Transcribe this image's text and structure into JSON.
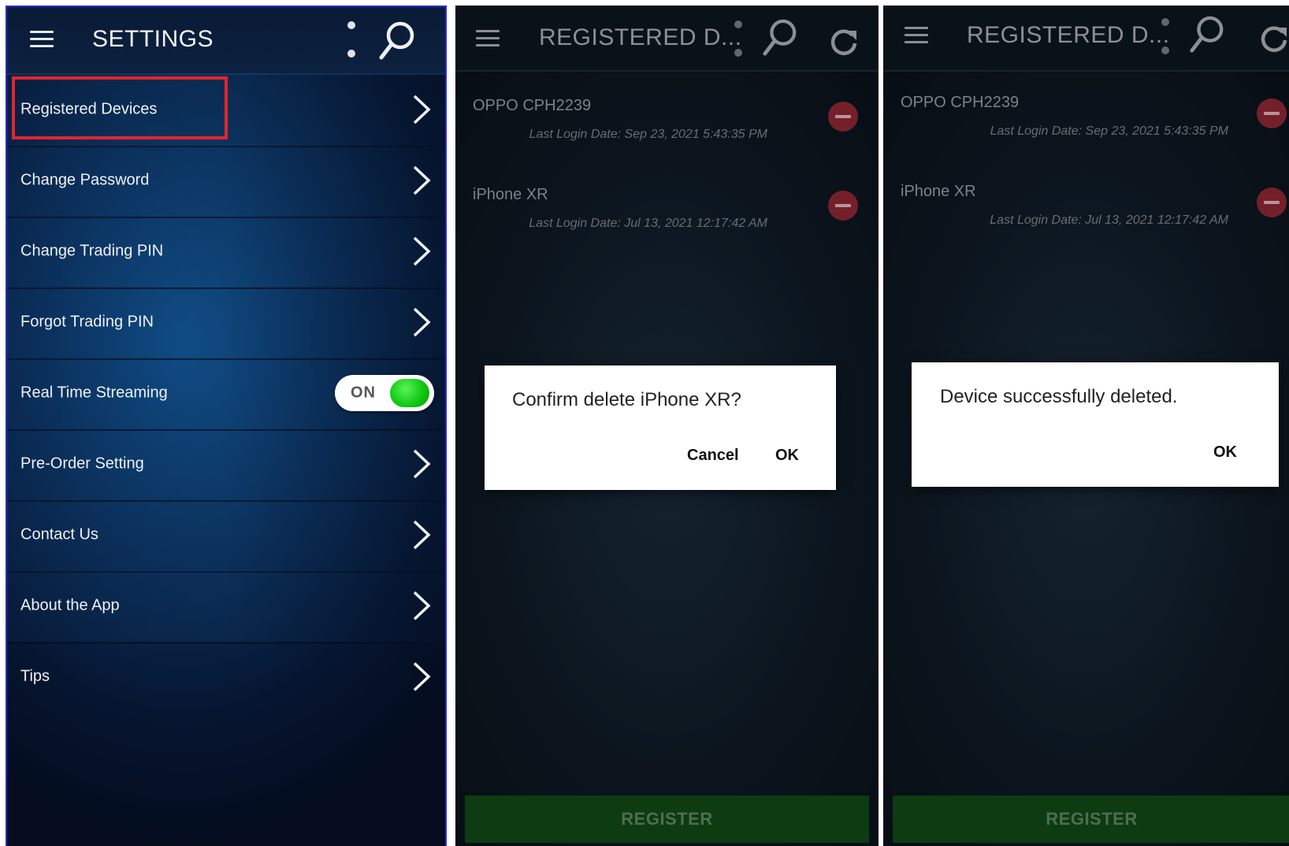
{
  "settings_screen": {
    "title": "SETTINGS",
    "items": [
      {
        "label": "Registered Devices",
        "type": "link"
      },
      {
        "label": "Change Password",
        "type": "link"
      },
      {
        "label": "Change Trading PIN",
        "type": "link"
      },
      {
        "label": "Forgot Trading PIN",
        "type": "link"
      },
      {
        "label": "Real Time Streaming",
        "type": "toggle",
        "toggle_text": "ON",
        "toggle_on": true
      },
      {
        "label": "Pre-Order Setting",
        "type": "link"
      },
      {
        "label": "Contact Us",
        "type": "link"
      },
      {
        "label": "About the App",
        "type": "link"
      },
      {
        "label": "Tips",
        "type": "link"
      }
    ],
    "highlight_color": "#e0262e",
    "toggle_color": "#12c912"
  },
  "confirm_screen": {
    "title": "REGISTERED D...",
    "devices": [
      {
        "name": "OPPO CPH2239",
        "last_login": "Last Login Date: Sep 23, 2021 5:43:35 PM"
      },
      {
        "name": "iPhone XR",
        "last_login": "Last Login Date: Jul 13, 2021 12:17:42 AM"
      }
    ],
    "dialog": {
      "message": "Confirm delete iPhone XR?",
      "cancel_label": "Cancel",
      "ok_label": "OK"
    },
    "register_label": "REGISTER"
  },
  "deleted_screen": {
    "title": "REGISTERED D...",
    "devices": [
      {
        "name": "OPPO CPH2239",
        "last_login": "Last Login Date: Sep 23, 2021 5:43:35 PM"
      },
      {
        "name": "iPhone XR",
        "last_login": "Last Login Date: Jul 13, 2021 12:17:42 AM"
      }
    ],
    "dialog": {
      "message": "Device successfully deleted.",
      "ok_label": "OK"
    },
    "register_label": "REGISTER"
  },
  "icons": {
    "menu": "hamburger-menu-icon",
    "more": "more-vertical-icon",
    "search": "search-icon",
    "refresh": "refresh-icon",
    "chevron": "chevron-right-icon",
    "remove": "remove-circle-icon"
  },
  "colors": {
    "register_bar": "#0d3b12",
    "remove_button": "#74202a",
    "settings_background": "#0a2c55"
  }
}
